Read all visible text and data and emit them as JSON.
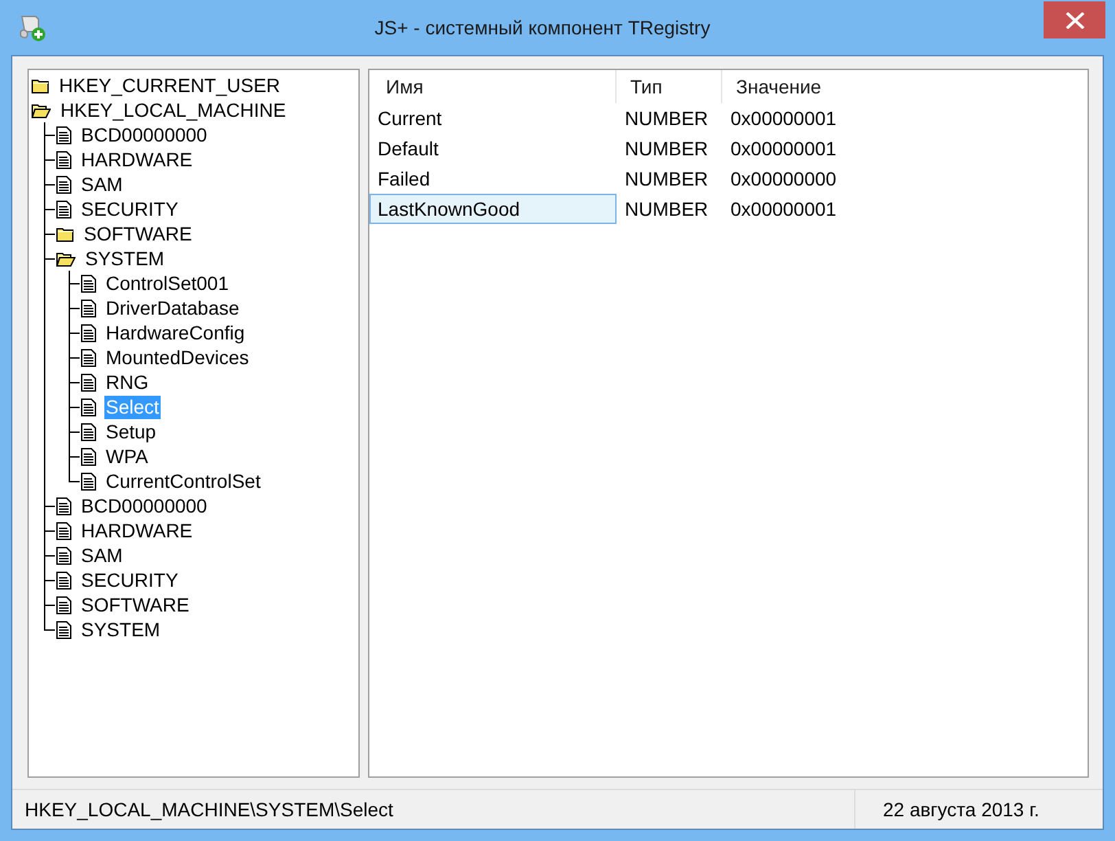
{
  "window": {
    "title": "JS+ - системный компонент TRegistry"
  },
  "tree": [
    {
      "label": "HKEY_CURRENT_USER",
      "kind": "folder",
      "expanded": false,
      "selected": false
    },
    {
      "label": "HKEY_LOCAL_MACHINE",
      "kind": "folder",
      "expanded": true,
      "selected": false,
      "children": [
        {
          "label": "BCD00000000",
          "kind": "key",
          "selected": false
        },
        {
          "label": "HARDWARE",
          "kind": "key",
          "selected": false
        },
        {
          "label": "SAM",
          "kind": "key",
          "selected": false
        },
        {
          "label": "SECURITY",
          "kind": "key",
          "selected": false
        },
        {
          "label": "SOFTWARE",
          "kind": "folder",
          "expanded": false,
          "selected": false
        },
        {
          "label": "SYSTEM",
          "kind": "folder",
          "expanded": true,
          "selected": false,
          "children": [
            {
              "label": "ControlSet001",
              "kind": "key",
              "selected": false
            },
            {
              "label": "DriverDatabase",
              "kind": "key",
              "selected": false
            },
            {
              "label": "HardwareConfig",
              "kind": "key",
              "selected": false
            },
            {
              "label": "MountedDevices",
              "kind": "key",
              "selected": false
            },
            {
              "label": "RNG",
              "kind": "key",
              "selected": false
            },
            {
              "label": "Select",
              "kind": "key",
              "selected": true
            },
            {
              "label": "Setup",
              "kind": "key",
              "selected": false
            },
            {
              "label": "WPA",
              "kind": "key",
              "selected": false
            },
            {
              "label": "CurrentControlSet",
              "kind": "key",
              "selected": false
            }
          ]
        },
        {
          "label": "BCD00000000",
          "kind": "key",
          "selected": false
        },
        {
          "label": "HARDWARE",
          "kind": "key",
          "selected": false
        },
        {
          "label": "SAM",
          "kind": "key",
          "selected": false
        },
        {
          "label": "SECURITY",
          "kind": "key",
          "selected": false
        },
        {
          "label": "SOFTWARE",
          "kind": "key",
          "selected": false
        },
        {
          "label": "SYSTEM",
          "kind": "key",
          "selected": false
        }
      ]
    }
  ],
  "table": {
    "columns": [
      "Имя",
      "Тип",
      "Значение"
    ],
    "rows": [
      {
        "name": "Current",
        "type": "NUMBER",
        "value": "0x00000001",
        "selected": false
      },
      {
        "name": "Default",
        "type": "NUMBER",
        "value": "0x00000001",
        "selected": false
      },
      {
        "name": "Failed",
        "type": "NUMBER",
        "value": "0x00000000",
        "selected": false
      },
      {
        "name": "LastKnownGood",
        "type": "NUMBER",
        "value": "0x00000001",
        "selected": true
      }
    ]
  },
  "status_bar": {
    "path": "HKEY_LOCAL_MACHINE\\SYSTEM\\Select",
    "date": "22 августа 2013 г."
  }
}
